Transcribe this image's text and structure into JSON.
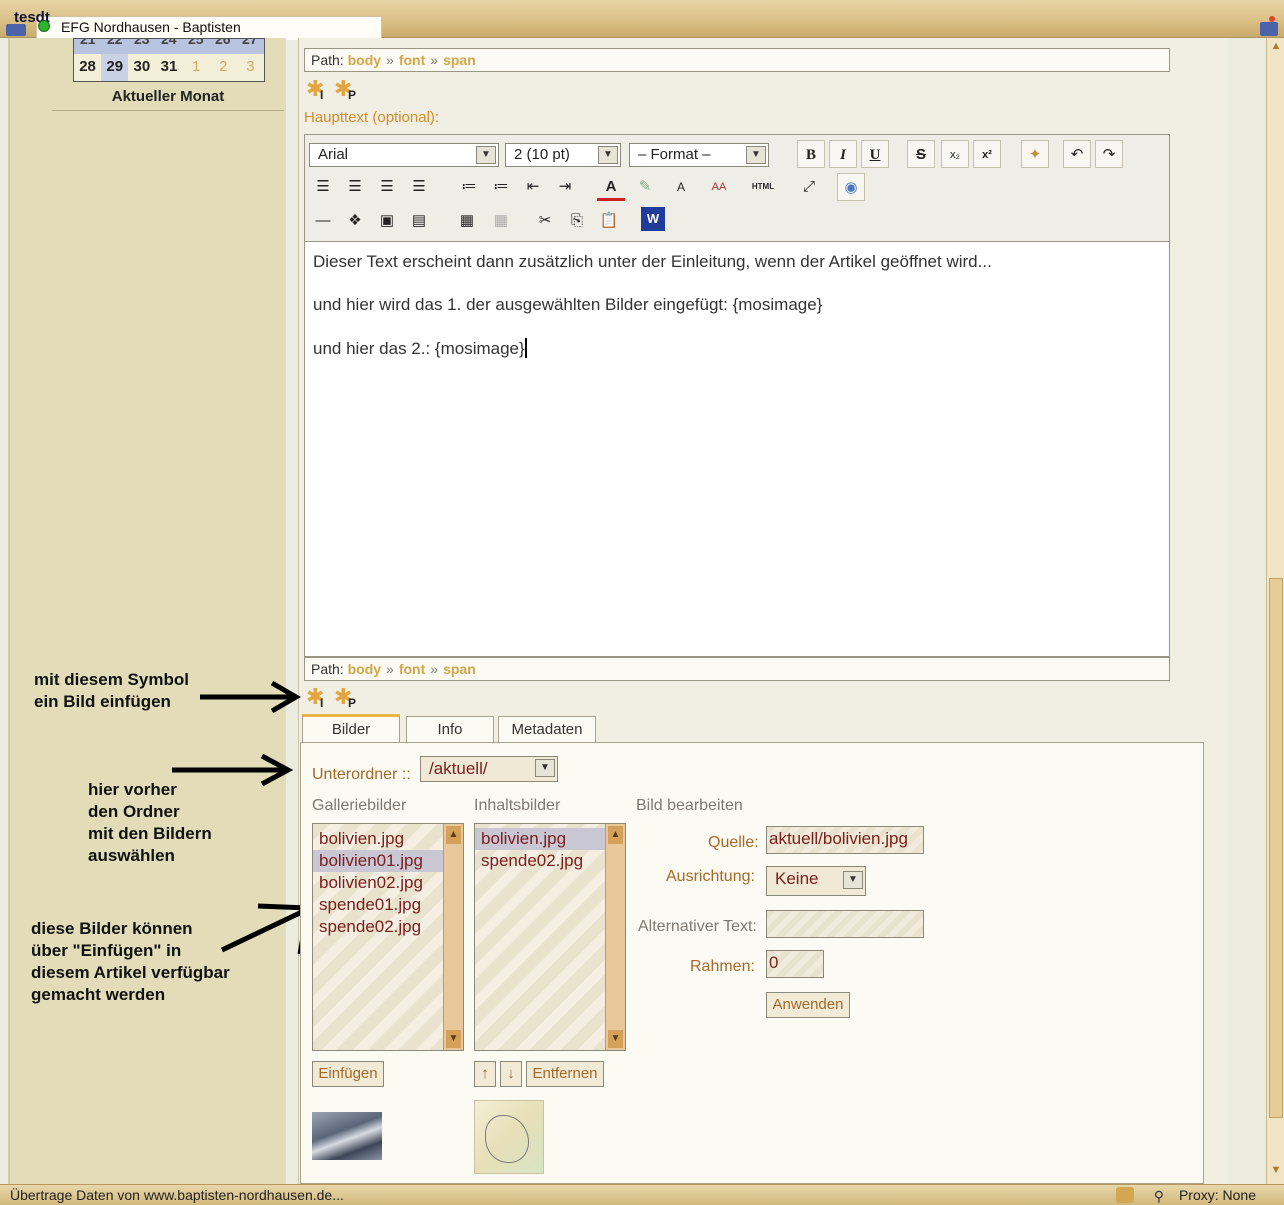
{
  "window": {
    "corner_text": "tesdt",
    "tab_title": "EFG Nordhausen - Baptisten"
  },
  "calendar": {
    "top_row": [
      "21",
      "22",
      "23",
      "24",
      "25",
      "26",
      "27"
    ],
    "bottom_row": [
      "28",
      "29",
      "30",
      "31",
      "1",
      "2",
      "3"
    ],
    "month_label": "Aktueller Monat"
  },
  "path_top": {
    "label": "Path:",
    "items": [
      "body",
      "font",
      "span"
    ]
  },
  "path_bottom": {
    "label": "Path:",
    "items": [
      "body",
      "font",
      "span"
    ]
  },
  "image_icons": {
    "insert_label": "I",
    "page_label": "P"
  },
  "haupttext_label": "Haupttext (optional):",
  "toolbar": {
    "font_select": "Arial",
    "size_select": "2 (10 pt)",
    "format_select": "– Format –",
    "bold": "B",
    "italic": "I",
    "underline": "U",
    "strike": "S",
    "sub": "x₂",
    "sup": "x²",
    "font_color": "A",
    "reset_font": "A",
    "font_size_btn": "AA",
    "html_btn": "HTML",
    "word_btn": "W"
  },
  "content": {
    "lines": [
      "Dieser Text erscheint dann zusätzlich unter der Einleitung, wenn der Artikel geöffnet wird...",
      "und hier wird das 1. der ausgewählten Bilder eingefügt: {mosimage}",
      "und hier das 2.: {mosimage}"
    ]
  },
  "annotations": {
    "symbol": [
      "mit diesem Symbol",
      "ein Bild einfügen"
    ],
    "folder": [
      "hier vorher",
      "den Ordner",
      "mit den Bildern",
      "auswählen"
    ],
    "images": [
      "diese Bilder können",
      "über \"Einfügen\" in",
      "diesem Artikel verfügbar",
      "gemacht werden"
    ]
  },
  "tabs": [
    "Bilder",
    "Info",
    "Metadaten"
  ],
  "bilder": {
    "subfolder_label": "Unterordner ::",
    "subfolder_value": "/aktuell/",
    "gallery_label": "Galleriebilder",
    "content_label": "Inhaltsbilder",
    "edit_label": "Bild bearbeiten",
    "gallery_items": [
      "bolivien.jpg",
      "bolivien01.jpg",
      "bolivien02.jpg",
      "spende01.jpg",
      "spende02.jpg"
    ],
    "content_items": [
      "bolivien.jpg",
      "spende02.jpg"
    ],
    "quelle_label": "Quelle:",
    "quelle_value": "aktuell/bolivien.jpg",
    "ausrichtung_label": "Ausrichtung:",
    "ausrichtung_value": "Keine",
    "alt_label": "Alternativer Text:",
    "alt_value": "",
    "rahmen_label": "Rahmen:",
    "rahmen_value": "0",
    "apply_button": "Anwenden",
    "insert_button": "Einfügen",
    "up_button": "↑",
    "down_button": "↓",
    "remove_button": "Entfernen"
  },
  "status": {
    "left": "Übertrage Daten von www.baptisten-nordhausen.de...",
    "right": "Proxy: None"
  }
}
